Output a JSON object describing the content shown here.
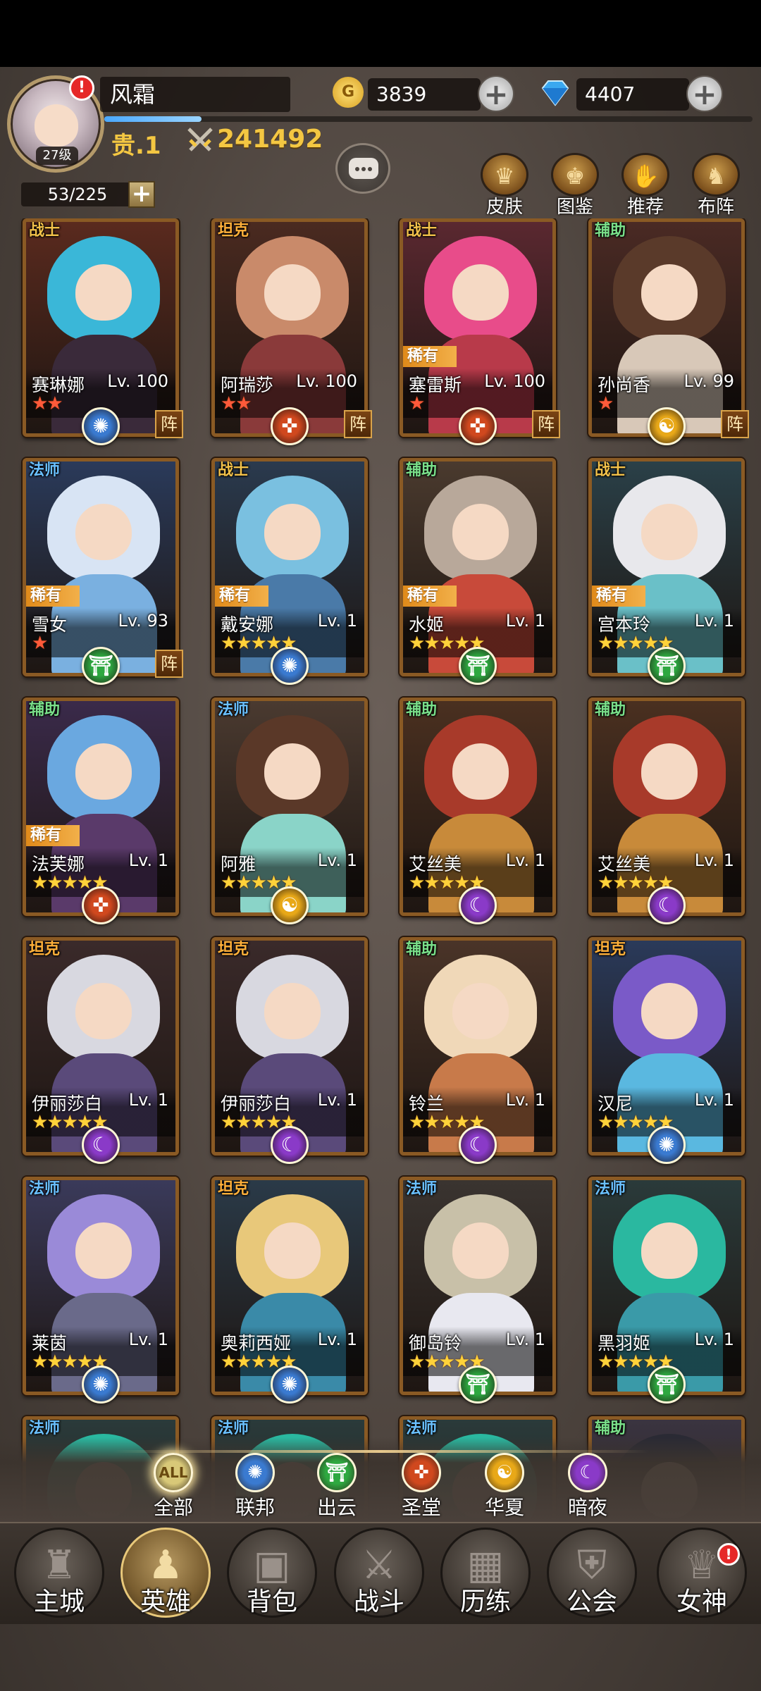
{
  "player": {
    "name": "风霜",
    "level_label": "27级",
    "vip_label": "贵.1",
    "power": "241492",
    "exp_progress": 0.15
  },
  "currencies": {
    "gold": {
      "icon": "G",
      "value": "3839"
    },
    "diamond": {
      "value": "4407"
    }
  },
  "capacity": "53/225",
  "function_buttons": [
    {
      "label": "皮肤",
      "icon": "skin-icon",
      "glyph": "♛"
    },
    {
      "label": "图鉴",
      "icon": "codex-icon",
      "glyph": "♚"
    },
    {
      "label": "推荐",
      "icon": "recommend-icon",
      "glyph": "✋"
    },
    {
      "label": "布阵",
      "icon": "formation-icon",
      "glyph": "♞"
    }
  ],
  "heroes": [
    {
      "class": "战士",
      "name": "赛琳娜",
      "level": "Lv. 100",
      "rarity": "",
      "stars": 2,
      "star_color": "red",
      "faction": "联邦",
      "in_lineup": true,
      "lineup_label": "阵",
      "hair": "#3ab7d8",
      "body": "#3a2a3a",
      "bg": "#5a2a1e"
    },
    {
      "class": "坦克",
      "name": "阿瑞莎",
      "level": "Lv. 100",
      "rarity": "",
      "stars": 2,
      "star_color": "red",
      "faction": "圣堂",
      "in_lineup": true,
      "lineup_label": "阵",
      "hair": "#c98a6a",
      "body": "#8a3a3a",
      "bg": "#4a2a20"
    },
    {
      "class": "战士",
      "name": "塞雷斯",
      "level": "Lv. 100",
      "rarity": "稀有",
      "stars": 1,
      "star_color": "red",
      "faction": "圣堂",
      "in_lineup": true,
      "lineup_label": "阵",
      "hair": "#e84c8a",
      "body": "#b83a4a",
      "bg": "#5a2830"
    },
    {
      "class": "辅助",
      "name": "孙尚香",
      "level": "Lv. 99",
      "rarity": "",
      "stars": 1,
      "star_color": "red",
      "faction": "华夏",
      "in_lineup": true,
      "lineup_label": "阵",
      "hair": "#5a3a2a",
      "body": "#d8c8b8",
      "bg": "#4a2a24"
    },
    {
      "class": "法师",
      "name": "雪女",
      "level": "Lv. 93",
      "rarity": "稀有",
      "stars": 1,
      "star_color": "red",
      "faction": "出云",
      "in_lineup": true,
      "lineup_label": "阵",
      "hair": "#d8e4f4",
      "body": "#7ab0e0",
      "bg": "#2a3a5a"
    },
    {
      "class": "战士",
      "name": "戴安娜",
      "level": "Lv. 1",
      "rarity": "稀有",
      "stars": 5,
      "star_color": "gold",
      "faction": "联邦",
      "in_lineup": false,
      "lineup_label": "",
      "hair": "#7ac0e0",
      "body": "#4a7aa8",
      "bg": "#2a3a4e"
    },
    {
      "class": "辅助",
      "name": "水姬",
      "level": "Lv. 1",
      "rarity": "稀有",
      "stars": 5,
      "star_color": "gold",
      "faction": "出云",
      "in_lineup": false,
      "lineup_label": "",
      "hair": "#b8a89a",
      "body": "#c84a3a",
      "bg": "#4a3a2e"
    },
    {
      "class": "战士",
      "name": "宫本玲",
      "level": "Lv. 1",
      "rarity": "稀有",
      "stars": 5,
      "star_color": "gold",
      "faction": "出云",
      "in_lineup": false,
      "lineup_label": "",
      "hair": "#e8e8ec",
      "body": "#6ac0c8",
      "bg": "#2a4048"
    },
    {
      "class": "辅助",
      "name": "法芙娜",
      "level": "Lv. 1",
      "rarity": "稀有",
      "stars": 5,
      "star_color": "gold",
      "faction": "圣堂",
      "in_lineup": false,
      "lineup_label": "",
      "hair": "#6aa8e0",
      "body": "#5a3a6a",
      "bg": "#3a2a4a"
    },
    {
      "class": "法师",
      "name": "阿雅",
      "level": "Lv. 1",
      "rarity": "",
      "stars": 5,
      "star_color": "gold",
      "faction": "华夏",
      "in_lineup": false,
      "lineup_label": "",
      "hair": "#5a3828",
      "body": "#8ad4c8",
      "bg": "#4a3a30"
    },
    {
      "class": "辅助",
      "name": "艾丝美",
      "level": "Lv. 1",
      "rarity": "",
      "stars": 5,
      "star_color": "gold",
      "faction": "暗夜",
      "in_lineup": false,
      "lineup_label": "",
      "hair": "#a83a2a",
      "body": "#c88a3a",
      "bg": "#4a3020"
    },
    {
      "class": "辅助",
      "name": "艾丝美",
      "level": "Lv. 1",
      "rarity": "",
      "stars": 5,
      "star_color": "gold",
      "faction": "暗夜",
      "in_lineup": false,
      "lineup_label": "",
      "hair": "#a83a2a",
      "body": "#c88a3a",
      "bg": "#4a3020"
    },
    {
      "class": "坦克",
      "name": "伊丽莎白",
      "level": "Lv. 1",
      "rarity": "",
      "stars": 5,
      "star_color": "gold",
      "faction": "暗夜",
      "in_lineup": false,
      "lineup_label": "",
      "hair": "#d8d8e0",
      "body": "#5a4a7a",
      "bg": "#3a2a2a"
    },
    {
      "class": "坦克",
      "name": "伊丽莎白",
      "level": "Lv. 1",
      "rarity": "",
      "stars": 5,
      "star_color": "gold",
      "faction": "暗夜",
      "in_lineup": false,
      "lineup_label": "",
      "hair": "#d8d8e0",
      "body": "#5a4a7a",
      "bg": "#3a2a2a"
    },
    {
      "class": "辅助",
      "name": "铃兰",
      "level": "Lv. 1",
      "rarity": "",
      "stars": 5,
      "star_color": "gold",
      "faction": "暗夜",
      "in_lineup": false,
      "lineup_label": "",
      "hair": "#f0d8b8",
      "body": "#c87a4a",
      "bg": "#4a3428"
    },
    {
      "class": "坦克",
      "name": "汉尼",
      "level": "Lv. 1",
      "rarity": "",
      "stars": 5,
      "star_color": "gold",
      "faction": "联邦",
      "in_lineup": false,
      "lineup_label": "",
      "hair": "#7a5ac8",
      "body": "#5ab8e0",
      "bg": "#2a3a5a"
    },
    {
      "class": "法师",
      "name": "莱茵",
      "level": "Lv. 1",
      "rarity": "",
      "stars": 5,
      "star_color": "gold",
      "faction": "联邦",
      "in_lineup": false,
      "lineup_label": "",
      "hair": "#9a8ad8",
      "body": "#6a6a8a",
      "bg": "#3a3a5a"
    },
    {
      "class": "坦克",
      "name": "奥莉西娅",
      "level": "Lv. 1",
      "rarity": "",
      "stars": 5,
      "star_color": "gold",
      "faction": "联邦",
      "in_lineup": false,
      "lineup_label": "",
      "hair": "#e8c87a",
      "body": "#3a8aa8",
      "bg": "#2a3a48"
    },
    {
      "class": "法师",
      "name": "御岛铃",
      "level": "Lv. 1",
      "rarity": "",
      "stars": 5,
      "star_color": "gold",
      "faction": "出云",
      "in_lineup": false,
      "lineup_label": "",
      "hair": "#c8c0a8",
      "body": "#e8e8f0",
      "bg": "#3a3430"
    },
    {
      "class": "法师",
      "name": "黑羽姬",
      "level": "Lv. 1",
      "rarity": "",
      "stars": 5,
      "star_color": "gold",
      "faction": "出云",
      "in_lineup": false,
      "lineup_label": "",
      "hair": "#2ab8a0",
      "body": "#3a9aa8",
      "bg": "#2a3a3a"
    },
    {
      "class": "法师",
      "name": "",
      "level": "",
      "rarity": "",
      "stars": 0,
      "star_color": "gold",
      "faction": "",
      "in_lineup": false,
      "lineup_label": "",
      "hair": "#2ab8a0",
      "body": "#3a9aa8",
      "bg": "#2a3a3a"
    },
    {
      "class": "法师",
      "name": "",
      "level": "",
      "rarity": "",
      "stars": 0,
      "star_color": "gold",
      "faction": "",
      "in_lineup": false,
      "lineup_label": "",
      "hair": "#2ab8a0",
      "body": "#3a9aa8",
      "bg": "#2a3a3a"
    },
    {
      "class": "法师",
      "name": "",
      "level": "",
      "rarity": "",
      "stars": 0,
      "star_color": "gold",
      "faction": "",
      "in_lineup": false,
      "lineup_label": "",
      "hair": "#2ab8a0",
      "body": "#3a9aa8",
      "bg": "#2a3a3a"
    },
    {
      "class": "辅助",
      "name": "",
      "level": "",
      "rarity": "",
      "stars": 0,
      "star_color": "gold",
      "faction": "",
      "in_lineup": false,
      "lineup_label": "",
      "hair": "#2a2a34",
      "body": "#6a6a7a",
      "bg": "#3a3440"
    }
  ],
  "factions": {
    "联邦": {
      "glyph": "✺",
      "color": "#3a7ad0"
    },
    "圣堂": {
      "glyph": "✜",
      "color": "#d0481e"
    },
    "华夏": {
      "glyph": "☯",
      "color": "#e8a818"
    },
    "出云": {
      "glyph": "⛩",
      "color": "#2ea840"
    },
    "暗夜": {
      "glyph": "☾",
      "color": "#8a3ac8"
    }
  },
  "class_colors": {
    "战士": "#f2c14a",
    "坦克": "#ffb03a",
    "辅助": "#7ae08a",
    "法师": "#6ac0ff"
  },
  "filters": [
    {
      "label": "全部",
      "glyph": "ALL",
      "color": "#d8c878",
      "selected": true
    },
    {
      "label": "联邦",
      "glyph": "✺",
      "color": "#3a7ad0",
      "selected": false
    },
    {
      "label": "出云",
      "glyph": "⛩",
      "color": "#2ea840",
      "selected": false
    },
    {
      "label": "圣堂",
      "glyph": "✜",
      "color": "#d0481e",
      "selected": false
    },
    {
      "label": "华夏",
      "glyph": "☯",
      "color": "#e8a818",
      "selected": false
    },
    {
      "label": "暗夜",
      "glyph": "☾",
      "color": "#8a3ac8",
      "selected": false
    }
  ],
  "nav": [
    {
      "label": "主城",
      "icon": "castle-icon",
      "glyph": "♜",
      "active": false,
      "badge": false
    },
    {
      "label": "英雄",
      "icon": "hero-icon",
      "glyph": "♟",
      "active": true,
      "badge": false
    },
    {
      "label": "背包",
      "icon": "backpack-icon",
      "glyph": "▣",
      "active": false,
      "badge": false
    },
    {
      "label": "战斗",
      "icon": "crossed-swords-icon",
      "glyph": "⚔",
      "active": false,
      "badge": false
    },
    {
      "label": "历练",
      "icon": "map-icon",
      "glyph": "▦",
      "active": false,
      "badge": false
    },
    {
      "label": "公会",
      "icon": "shield-icon",
      "glyph": "⛨",
      "active": false,
      "badge": false
    },
    {
      "label": "女神",
      "icon": "goddess-icon",
      "glyph": "♕",
      "active": false,
      "badge": true
    }
  ],
  "badge_symbol": "!"
}
